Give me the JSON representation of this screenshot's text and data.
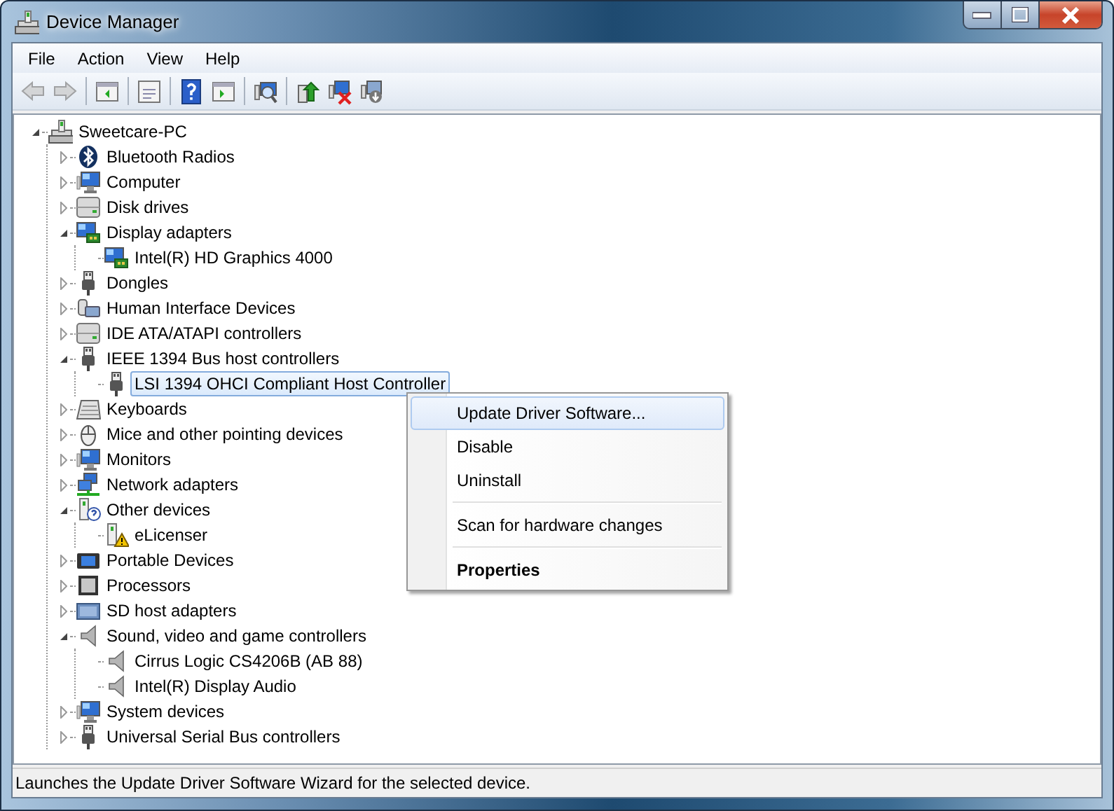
{
  "window": {
    "title": "Device Manager"
  },
  "menu_bar": [
    {
      "label": "File"
    },
    {
      "label": "Action"
    },
    {
      "label": "View"
    },
    {
      "label": "Help"
    }
  ],
  "toolbar": [
    [
      {
        "kind": "back",
        "disabled": true
      },
      {
        "kind": "forward",
        "disabled": true
      }
    ],
    [
      {
        "kind": "console",
        "disabled": false
      }
    ],
    [
      {
        "kind": "properties",
        "disabled": false
      }
    ],
    [
      {
        "kind": "help",
        "disabled": false
      },
      {
        "kind": "action",
        "disabled": false
      }
    ],
    [
      {
        "kind": "scan",
        "disabled": false
      }
    ],
    [
      {
        "kind": "update",
        "disabled": false
      },
      {
        "kind": "uninstall",
        "disabled": false
      },
      {
        "kind": "disable",
        "disabled": false
      }
    ]
  ],
  "tree": {
    "label": "Sweetcare-PC",
    "kind": "computer",
    "expanded": true,
    "selected": false,
    "children": [
      {
        "label": "Bluetooth Radios",
        "kind": "bluetooth",
        "expanded": false,
        "selected": false
      },
      {
        "label": "Computer",
        "kind": "monitor",
        "expanded": false,
        "selected": false
      },
      {
        "label": "Disk drives",
        "kind": "drive",
        "expanded": false,
        "selected": false
      },
      {
        "label": "Display adapters",
        "kind": "display",
        "expanded": true,
        "selected": false,
        "children": [
          {
            "label": "Intel(R) HD Graphics 4000",
            "kind": "display",
            "selected": false
          }
        ]
      },
      {
        "label": "Dongles",
        "kind": "plug",
        "expanded": false,
        "selected": false
      },
      {
        "label": "Human Interface Devices",
        "kind": "hid",
        "expanded": false,
        "selected": false
      },
      {
        "label": "IDE ATA/ATAPI controllers",
        "kind": "drive",
        "expanded": false,
        "selected": false
      },
      {
        "label": "IEEE 1394 Bus host controllers",
        "kind": "plug",
        "expanded": true,
        "selected": false,
        "children": [
          {
            "label": "LSI 1394 OHCI Compliant Host Controller",
            "kind": "plug",
            "selected": true
          }
        ]
      },
      {
        "label": "Keyboards",
        "kind": "keyboard",
        "expanded": false,
        "selected": false
      },
      {
        "label": "Mice and other pointing devices",
        "kind": "mouse",
        "expanded": false,
        "selected": false
      },
      {
        "label": "Monitors",
        "kind": "monitor",
        "expanded": false,
        "selected": false
      },
      {
        "label": "Network adapters",
        "kind": "network",
        "expanded": false,
        "selected": false
      },
      {
        "label": "Other devices",
        "kind": "unknown",
        "expanded": true,
        "selected": false,
        "children": [
          {
            "label": "eLicenser",
            "kind": "warning",
            "selected": false
          }
        ]
      },
      {
        "label": "Portable Devices",
        "kind": "portable",
        "expanded": false,
        "selected": false
      },
      {
        "label": "Processors",
        "kind": "chip",
        "expanded": false,
        "selected": false
      },
      {
        "label": "SD host adapters",
        "kind": "card",
        "expanded": false,
        "selected": false
      },
      {
        "label": "Sound, video and game controllers",
        "kind": "speaker",
        "expanded": true,
        "selected": false,
        "children": [
          {
            "label": "Cirrus Logic CS4206B (AB 88)",
            "kind": "speaker",
            "selected": false
          },
          {
            "label": "Intel(R) Display Audio",
            "kind": "speaker",
            "selected": false
          }
        ]
      },
      {
        "label": "System devices",
        "kind": "monitor",
        "expanded": false,
        "selected": false
      },
      {
        "label": "Universal Serial Bus controllers",
        "kind": "plug",
        "expanded": false,
        "selected": false
      }
    ]
  },
  "context_menu": [
    [
      {
        "label": "Update Driver Software...",
        "selected": true,
        "default": false
      },
      {
        "label": "Disable",
        "selected": false,
        "default": false
      },
      {
        "label": "Uninstall",
        "selected": false,
        "default": false
      }
    ],
    [
      {
        "label": "Scan for hardware changes",
        "selected": false,
        "default": false
      }
    ],
    [
      {
        "label": "Properties",
        "selected": false,
        "default": true
      }
    ]
  ],
  "status_bar": "Launches the Update Driver Software Wizard for the selected device."
}
